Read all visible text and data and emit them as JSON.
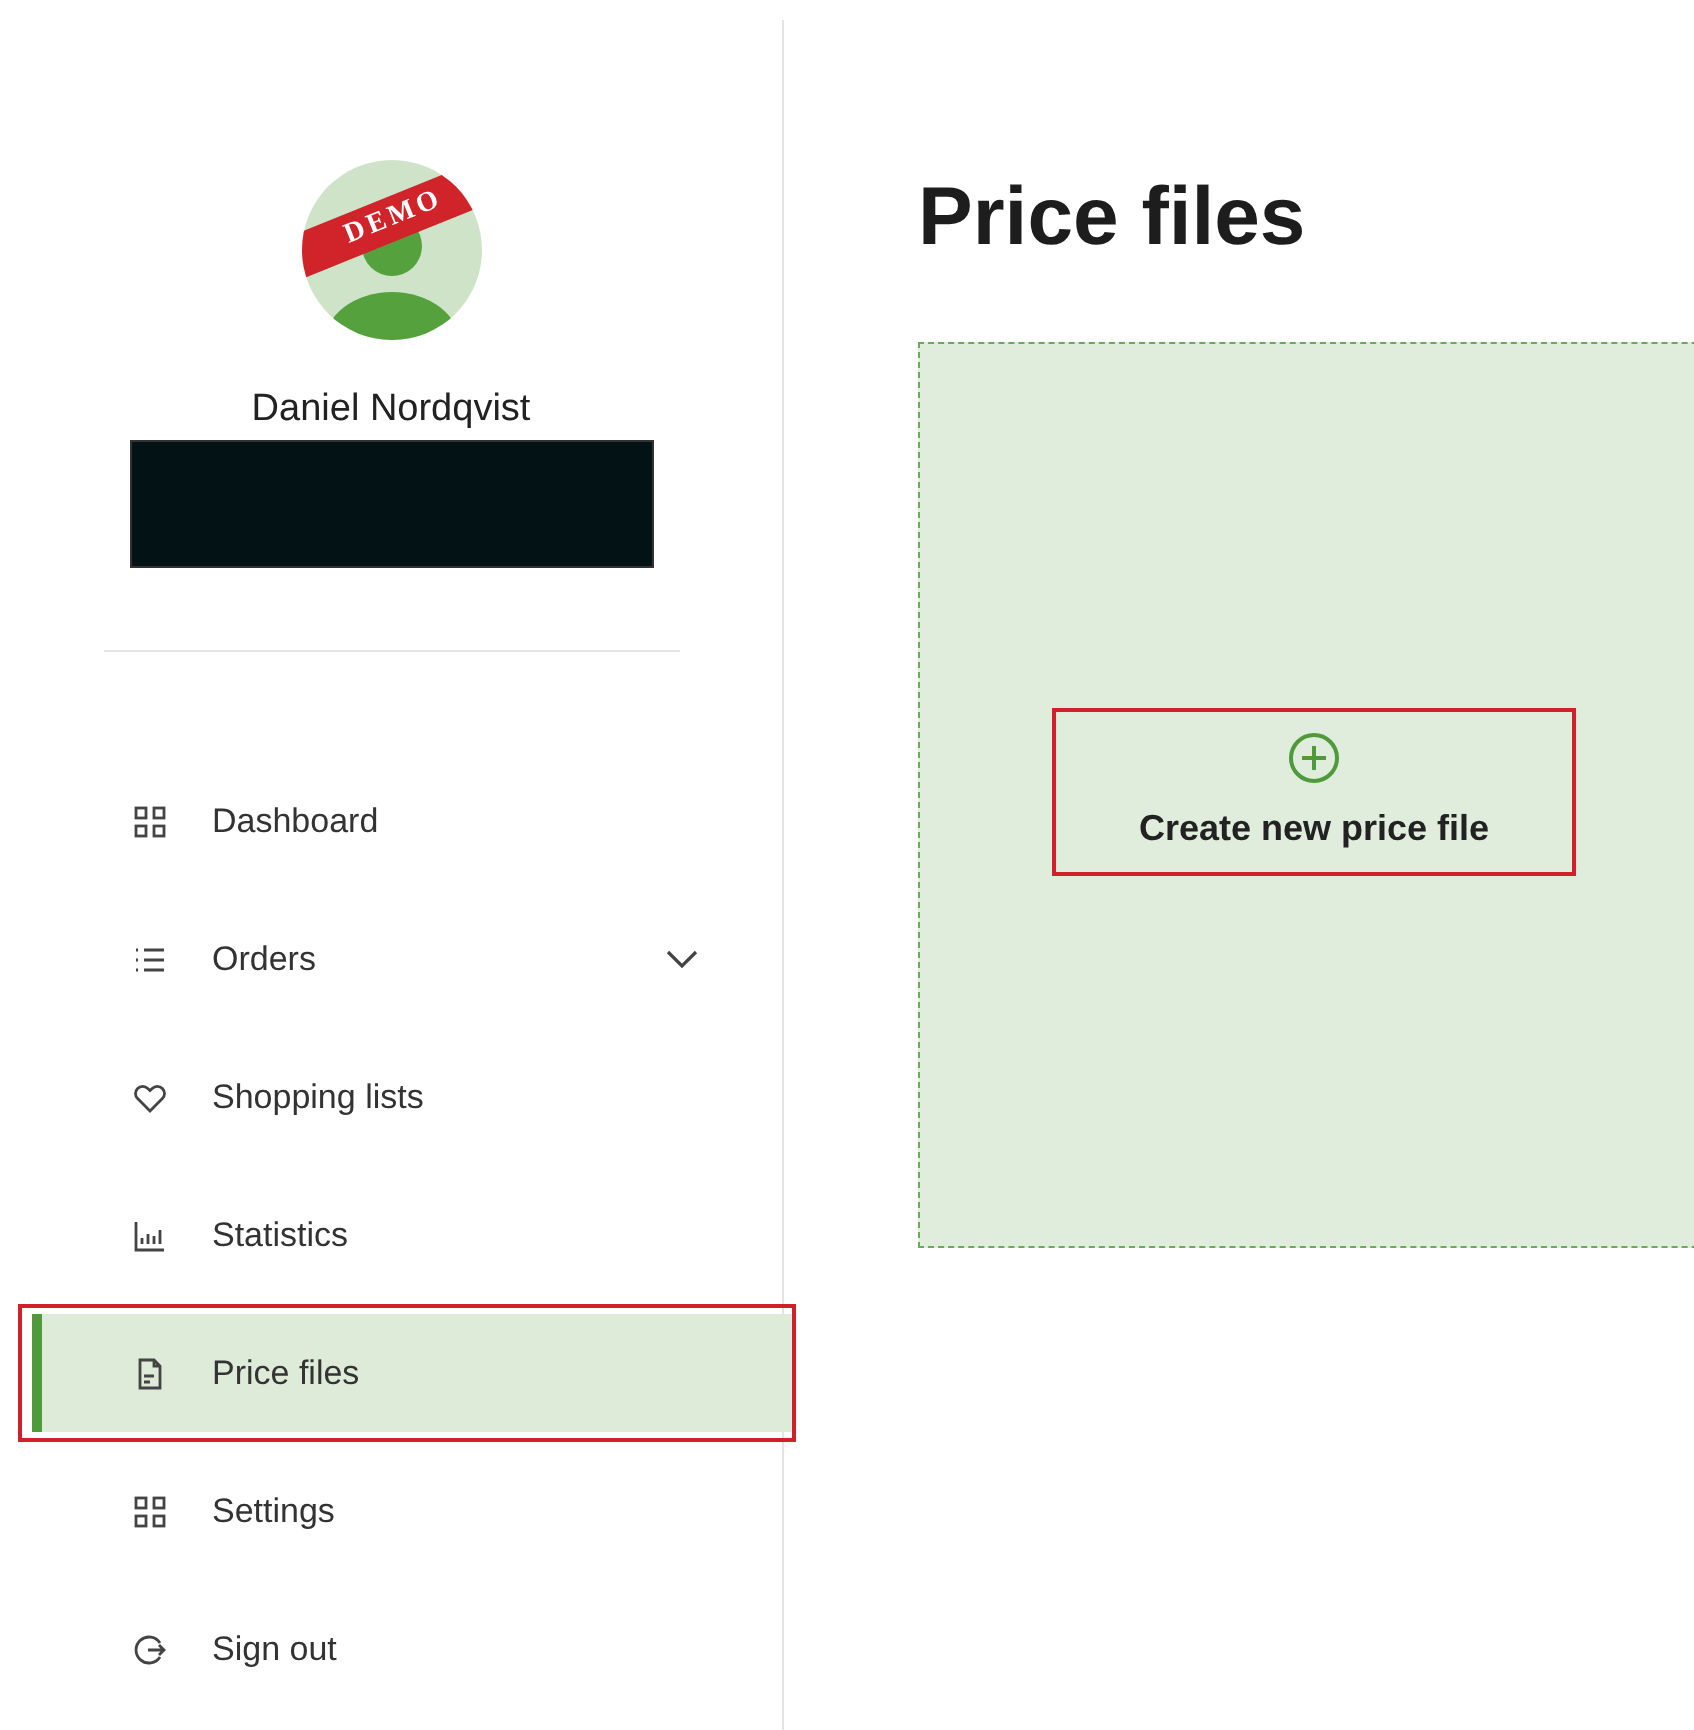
{
  "profile": {
    "ribbon": "DEMO",
    "name": "Daniel Nordqvist",
    "details_redacted": true
  },
  "nav": [
    {
      "label": "Dashboard",
      "selected": false,
      "highlighted": false
    },
    {
      "label": "Orders",
      "selected": false,
      "highlighted": false,
      "expanded": false
    },
    {
      "label": "Shopping lists",
      "selected": false,
      "highlighted": false
    },
    {
      "label": "Statistics",
      "selected": false,
      "highlighted": false
    },
    {
      "label": "Price files",
      "selected": true,
      "highlighted": true
    },
    {
      "label": "Settings",
      "selected": false,
      "highlighted": false
    },
    {
      "label": "Sign out",
      "selected": false,
      "highlighted": false
    }
  ],
  "main": {
    "title": "Price files",
    "create_button": {
      "label": "Create new price file",
      "highlighted": true
    }
  }
}
